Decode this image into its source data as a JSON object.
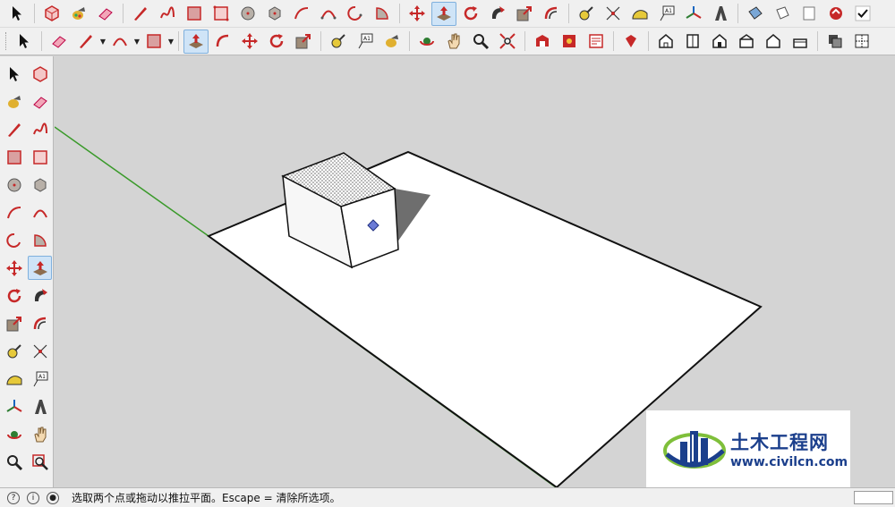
{
  "toolbar_top": {
    "tools": [
      "select",
      "make-component",
      "paint-bucket",
      "eraser",
      "pencil",
      "freehand",
      "rectangle",
      "rotated-rectangle",
      "circle",
      "polygon",
      "arc",
      "two-point-arc",
      "three-point-arc",
      "pie",
      "move",
      "push-pull",
      "rotate",
      "follow-me",
      "scale",
      "offset",
      "tape-measure",
      "dimension",
      "protractor",
      "text",
      "axes",
      "3d-text",
      "section-plane",
      "paste",
      "match-photo",
      "check"
    ]
  },
  "toolbar_second": {
    "tools": [
      "select",
      "eraser",
      "line",
      "arc",
      "shapes",
      "push-pull",
      "offset",
      "move",
      "rotate",
      "scale",
      "tape-measure",
      "text",
      "paint-bucket",
      "orbit",
      "pan",
      "zoom",
      "zoom-extents",
      "warehouse",
      "extension-warehouse",
      "layout",
      "ruby-console",
      "iso-view",
      "top-view",
      "front-view",
      "right-view",
      "back-view",
      "left-view",
      "xray",
      "back-edges"
    ],
    "text_tool_label": "A1"
  },
  "left_toolbar": {
    "tools": [
      "select",
      "make-component",
      "paint-bucket",
      "eraser",
      "pencil",
      "freehand",
      "rectangle",
      "rotated-rectangle",
      "circle",
      "polygon",
      "arc",
      "two-point-arc",
      "three-point-arc",
      "pie",
      "move",
      "push-pull",
      "rotate",
      "follow-me",
      "scale",
      "offset",
      "tape-measure",
      "dimension",
      "protractor",
      "text",
      "axes",
      "3d-text",
      "orbit",
      "pan",
      "zoom",
      "zoom-window"
    ],
    "text_tool_label": "A1"
  },
  "status": {
    "hint": "选取两个点或拖动以推拉平面。Escape = 清除所选项。"
  },
  "watermark": {
    "title": "土木工程网",
    "url": "www.civilcn.com"
  },
  "colors": {
    "accent_red": "#c62828",
    "accent_blue": "#1b3f8c",
    "axis_green": "#3a9a2a",
    "viewport_bg": "#d4d4d4"
  }
}
